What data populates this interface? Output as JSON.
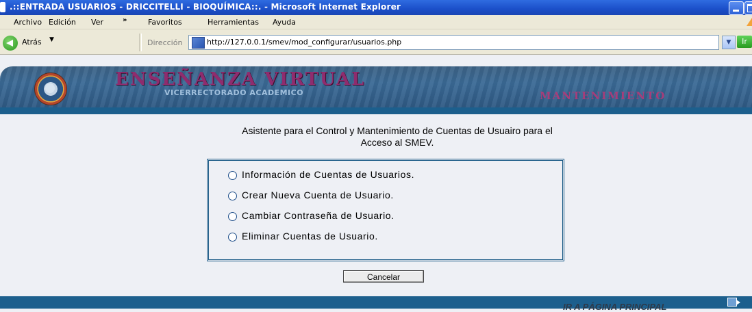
{
  "window": {
    "title": ".::ENTRADA USUARIOS - DRICCITELLI - BIOQUÍMICA::. - Microsoft Internet Explorer"
  },
  "menu": {
    "items": [
      "Archivo",
      "Edición",
      "Ver",
      "Favoritos",
      "Herramientas",
      "Ayuda"
    ],
    "overflow": "»"
  },
  "toolbar": {
    "back_label": "Atrás",
    "address_label": "Dirección",
    "url": "http://127.0.0.1/smev/mod_configurar/usuarios.php",
    "go_label": "Ir"
  },
  "banner": {
    "title": "ENSEÑANZA VIRTUAL",
    "subtitle": "VICERRECTORADO ACADEMICO",
    "section": "MANTENIMIENTO"
  },
  "main": {
    "heading_line1": "Asistente para el Control y Mantenimiento de Cuentas de Usuairo para el",
    "heading_line2": "Acceso al SMEV.",
    "options": [
      "Información de Cuentas de Usuarios.",
      "Crear Nueva Cuenta de Usuario.",
      "Cambiar Contraseña de Usuario.",
      "Eliminar Cuentas de Usuario."
    ],
    "cancel_label": "Cancelar"
  },
  "footer": {
    "link": "IR A PÁGINA PRINCIPAL"
  },
  "colors": {
    "title_bar": "#1b4fc9",
    "banner": "#3b6a96",
    "stripe": "#1c5f8d",
    "banner_title": "#8f2c6e",
    "page_bg": "#eef0f5"
  }
}
